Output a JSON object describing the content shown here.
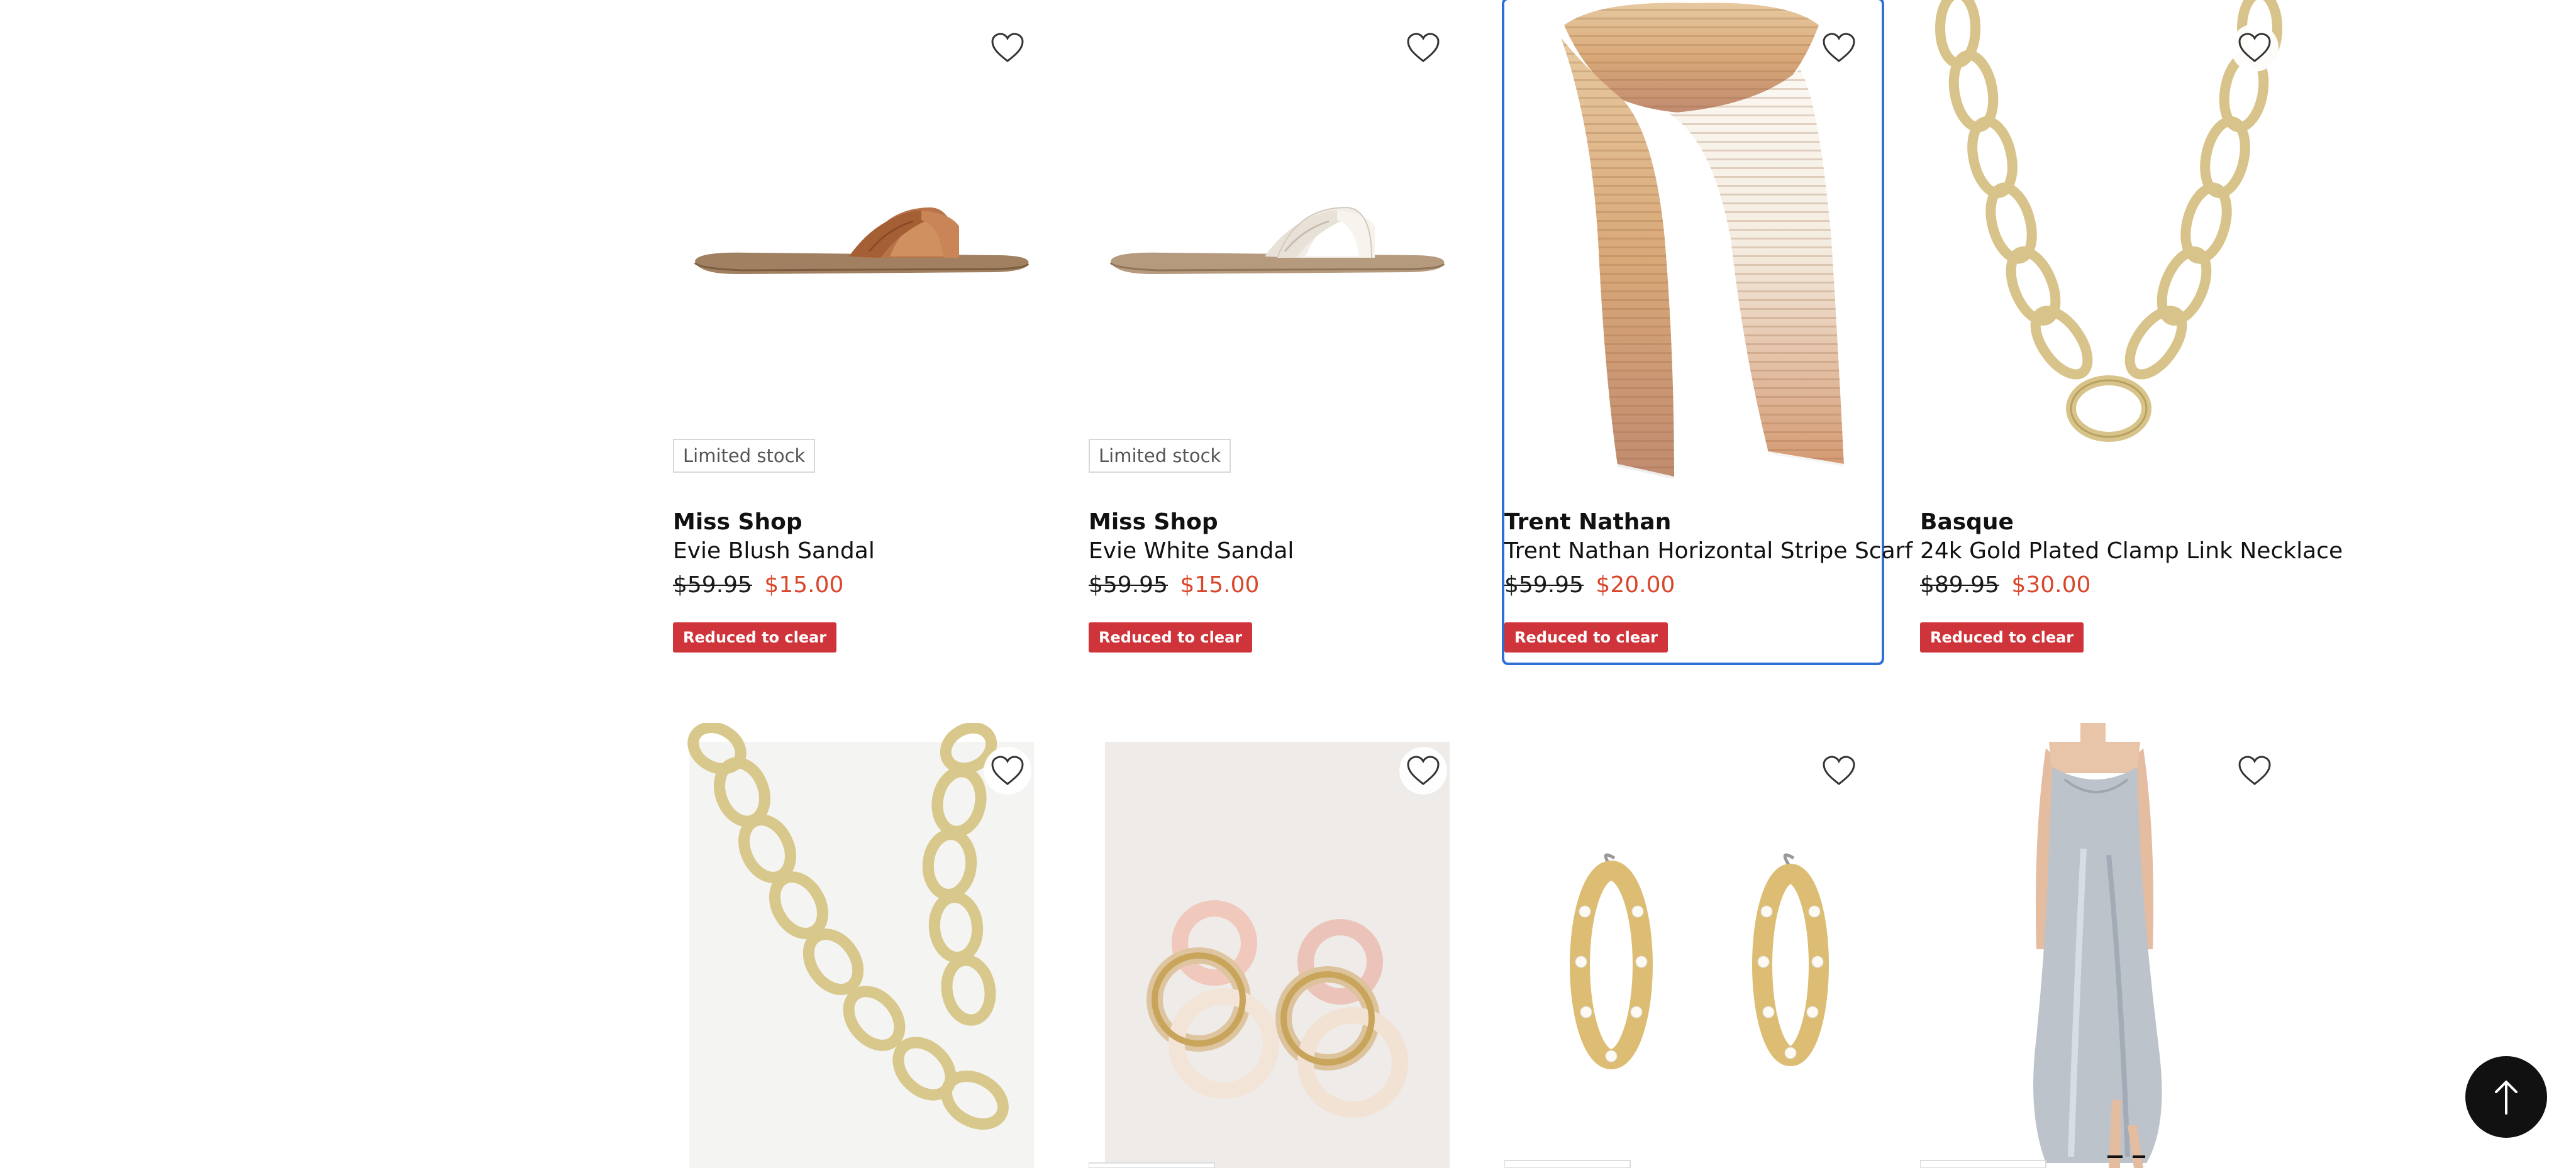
{
  "products_row1": [
    {
      "stock": "Limited stock",
      "brand": "Miss Shop",
      "name": "Evie Blush Sandal",
      "was_price": "$59.95",
      "now_price": "$15.00",
      "promo": "Reduced to clear",
      "image": "tan-strappy-slide-sandal"
    },
    {
      "stock": "Limited stock",
      "brand": "Miss Shop",
      "name": "Evie White Sandal",
      "was_price": "$59.95",
      "now_price": "$15.00",
      "promo": "Reduced to clear",
      "image": "white-strappy-slide-sandal"
    },
    {
      "brand": "Trent Nathan",
      "name": "Trent Nathan Horizontal Stripe Scarf",
      "was_price": "$59.95",
      "now_price": "$20.00",
      "promo": "Reduced to clear",
      "image": "stripe-ombre-scarf"
    },
    {
      "brand": "Basque",
      "name": "24k Gold Plated Clamp Link Necklace",
      "was_price": "$89.95",
      "now_price": "$30.00",
      "promo": "Reduced to clear",
      "image": "gold-oval-link-necklace"
    }
  ],
  "products_row2": [
    {
      "image": "gold-chunky-chain-necklace"
    },
    {
      "image": "pink-resin-gold-hoop-earrings"
    },
    {
      "image": "gold-pearl-hoop-earrings"
    },
    {
      "image": "silver-satin-cowl-slip-dress"
    }
  ],
  "colors": {
    "sale_price": "#d9472b",
    "promo_badge": "#d0343b",
    "focus_ring": "#2f6fd6",
    "back_to_top": "#111111"
  },
  "icons": {
    "wishlist": "heart-outline-icon",
    "back_to_top": "arrow-up-icon"
  }
}
